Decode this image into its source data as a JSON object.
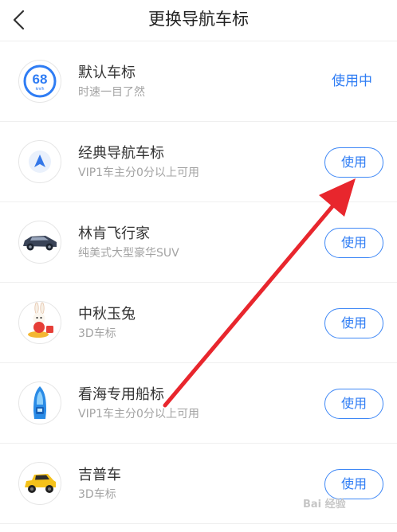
{
  "header": {
    "title": "更换导航车标"
  },
  "items": [
    {
      "title": "默认车标",
      "subtitle": "时速一目了然",
      "action": "使用中",
      "icon": "speedometer-68-icon",
      "speed": "68",
      "unit": "km/h"
    },
    {
      "title": "经典导航车标",
      "subtitle": "VIP1车主分0分以上可用",
      "action": "使用",
      "icon": "navigation-arrow-icon"
    },
    {
      "title": "林肯飞行家",
      "subtitle": "纯美式大型豪华SUV",
      "action": "使用",
      "icon": "suv-car-icon"
    },
    {
      "title": "中秋玉兔",
      "subtitle": "3D车标",
      "action": "使用",
      "icon": "jade-rabbit-icon"
    },
    {
      "title": "看海专用船标",
      "subtitle": "VIP1车主分0分以上可用",
      "action": "使用",
      "icon": "boat-icon"
    },
    {
      "title": "吉普车",
      "subtitle": "3D车标",
      "action": "使用",
      "icon": "jeep-icon"
    }
  ],
  "watermark": "Bai 经验",
  "colors": {
    "accent": "#2f7df4",
    "annotation_arrow": "#e8262d"
  }
}
